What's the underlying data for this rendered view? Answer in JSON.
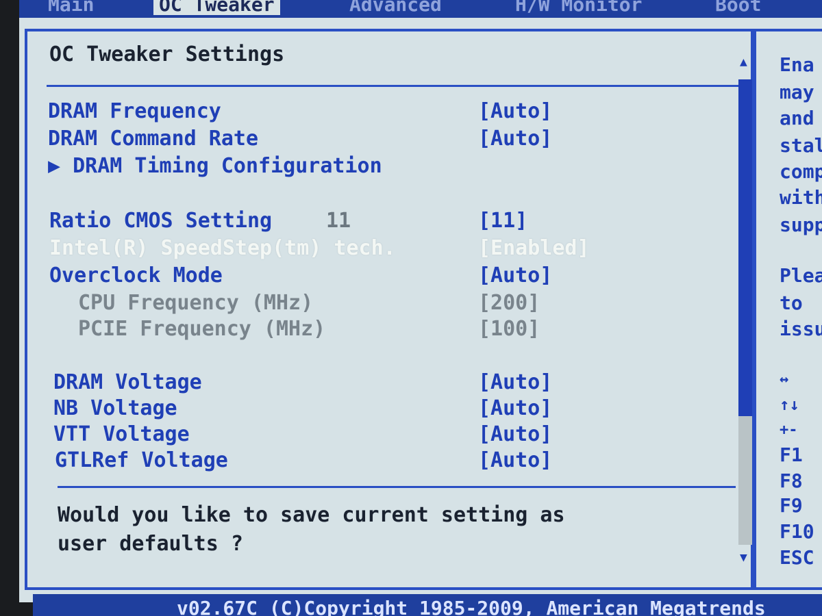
{
  "tabs": [
    {
      "label": "Main"
    },
    {
      "label": "OC Tweaker"
    },
    {
      "label": "Advanced"
    },
    {
      "label": "H/W Monitor"
    },
    {
      "label": "Boot"
    }
  ],
  "page_title": "OC Tweaker Settings",
  "settings": {
    "dram_frequency": {
      "label": "DRAM Frequency",
      "value": "[Auto]"
    },
    "dram_command_rate": {
      "label": "DRAM Command Rate",
      "value": "[Auto]"
    },
    "dram_timing_configuration": {
      "label": "▶ DRAM Timing Configuration"
    },
    "ratio_cmos_setting": {
      "label": "Ratio CMOS Setting",
      "current": "11",
      "value": "[11]"
    },
    "speedstep": {
      "label": "Intel(R) SpeedStep(tm) tech.",
      "value": "[Enabled]"
    },
    "overclock_mode": {
      "label": "Overclock Mode",
      "value": "[Auto]"
    },
    "cpu_frequency": {
      "label": "CPU Frequency (MHz)",
      "value": "[200]"
    },
    "pcie_frequency": {
      "label": "PCIE Frequency (MHz)",
      "value": "[100]"
    },
    "dram_voltage": {
      "label": "DRAM Voltage",
      "value": "[Auto]"
    },
    "nb_voltage": {
      "label": "NB Voltage",
      "value": "[Auto]"
    },
    "vtt_voltage": {
      "label": "VTT Voltage",
      "value": "[Auto]"
    },
    "gtlref_voltage": {
      "label": "GTLRef Voltage",
      "value": "[Auto]"
    }
  },
  "help_prompt": "Would you like to save current setting as\nuser defaults ?",
  "right_panel": {
    "lines": [
      "Ena",
      "may",
      "and",
      "stal",
      "comp",
      "with",
      "supp",
      "",
      "Plea",
      "to",
      "issu"
    ],
    "keys": [
      "↔",
      "↑↓",
      "+-",
      "F1",
      "F8",
      "F9",
      "F10",
      "ESC"
    ]
  },
  "scroll": {
    "up": "▲",
    "down": "▼"
  },
  "footer": {
    "copyright": "v02.67C (C)Copyright 1985-2009, American Megatrends"
  }
}
